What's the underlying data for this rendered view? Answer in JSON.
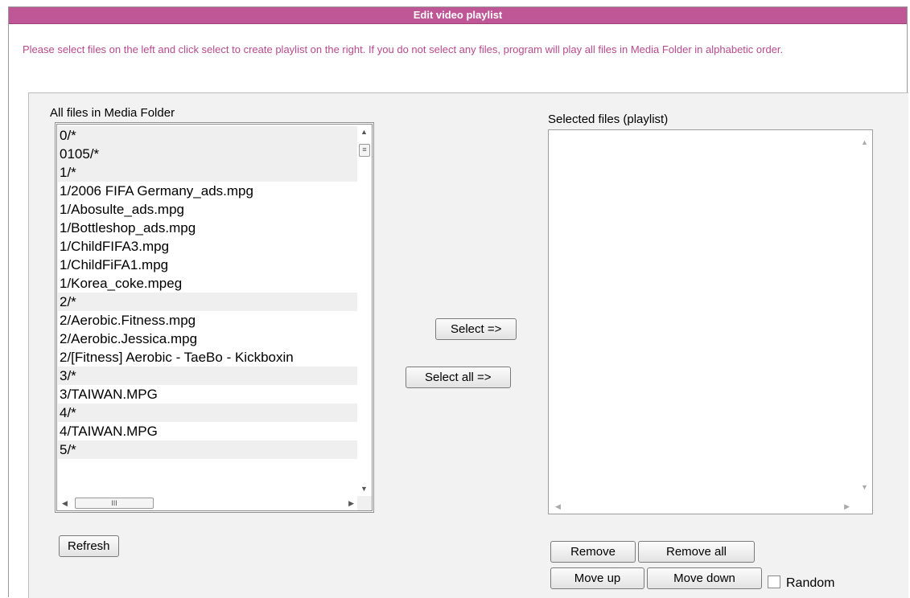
{
  "header": {
    "title": "Edit video playlist"
  },
  "instructions": "Please select files on the left and click select to create playlist on the right. If you do not select any files, program will play all files in Media Folder in alphabetic order.",
  "left_panel": {
    "label": "All files in Media Folder",
    "items": [
      {
        "text": "0/*",
        "group": true
      },
      {
        "text": "0105/*",
        "group": true
      },
      {
        "text": "1/*",
        "group": true
      },
      {
        "text": "1/2006 FIFA Germany_ads.mpg",
        "group": false
      },
      {
        "text": "1/Abosulte_ads.mpg",
        "group": false
      },
      {
        "text": "1/Bottleshop_ads.mpg",
        "group": false
      },
      {
        "text": "1/ChildFIFA3.mpg",
        "group": false
      },
      {
        "text": "1/ChildFiFA1.mpg",
        "group": false
      },
      {
        "text": "1/Korea_coke.mpeg",
        "group": false
      },
      {
        "text": "2/*",
        "group": true
      },
      {
        "text": "2/Aerobic.Fitness.mpg",
        "group": false
      },
      {
        "text": "2/Aerobic.Jessica.mpg",
        "group": false
      },
      {
        "text": "2/[Fitness] Aerobic - TaeBo - Kickboxin",
        "group": false
      },
      {
        "text": "3/*",
        "group": true
      },
      {
        "text": "3/TAIWAN.MPG",
        "group": false
      },
      {
        "text": "4/*",
        "group": true
      },
      {
        "text": "4/TAIWAN.MPG",
        "group": false
      },
      {
        "text": "5/*",
        "group": true
      }
    ],
    "refresh_label": "Refresh"
  },
  "middle": {
    "select_label": "Select =>",
    "select_all_label": "Select all =>"
  },
  "right_panel": {
    "label": "Selected files (playlist)",
    "items": [],
    "remove_label": "Remove",
    "remove_all_label": "Remove all",
    "move_up_label": "Move up",
    "move_down_label": "Move down",
    "random_label": "Random",
    "random_checked": false
  },
  "icons": {
    "scroll_up": "scroll-up-arrow-icon",
    "scroll_down": "scroll-down-arrow-icon",
    "scroll_left": "scroll-left-arrow-icon",
    "scroll_right": "scroll-right-arrow-icon"
  },
  "colors": {
    "title_bar": "#bf5797",
    "instructions_text": "#b84a8e",
    "panel_bg": "#f2f2f2"
  }
}
